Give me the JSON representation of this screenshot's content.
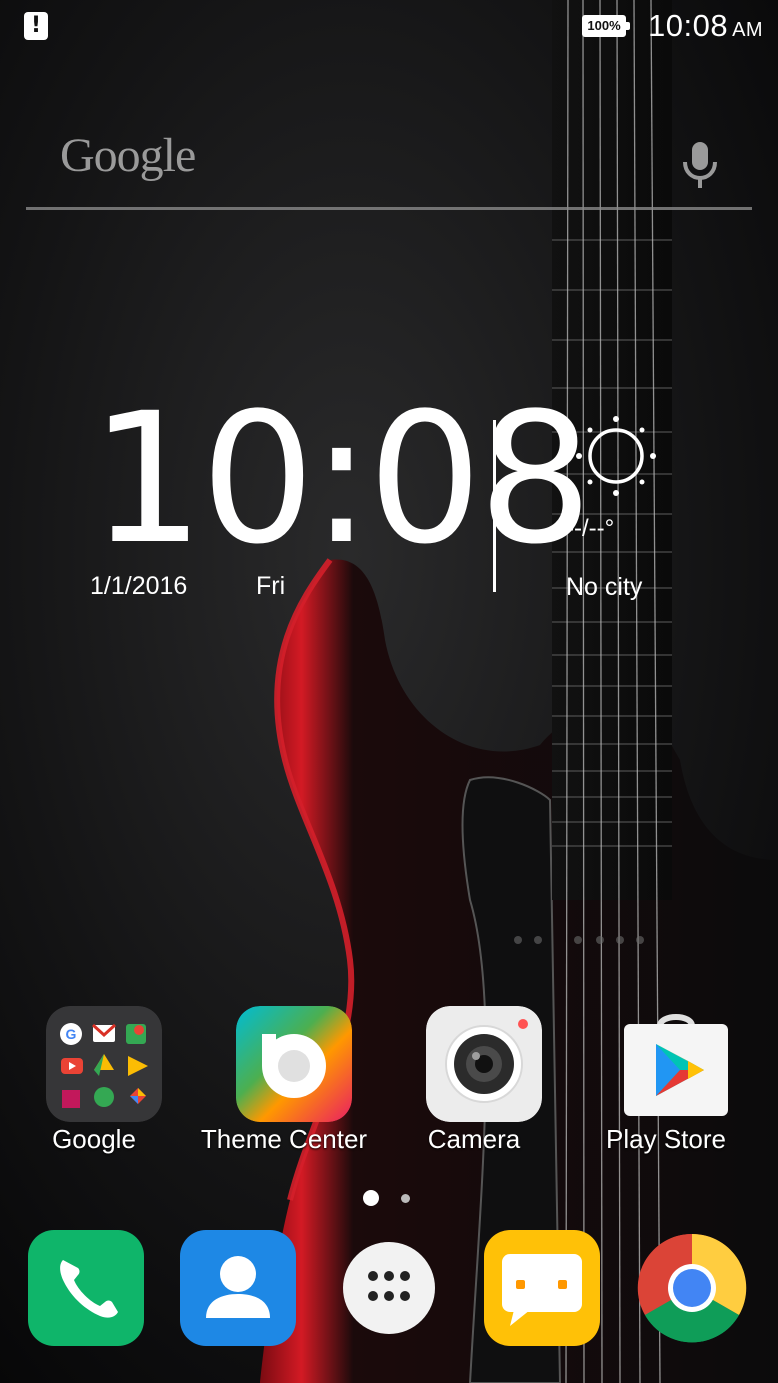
{
  "status_bar": {
    "time": "10:08",
    "ampm": "AM",
    "battery": "100%"
  },
  "search": {
    "logo": "Google"
  },
  "clock_widget": {
    "time_hours": "10",
    "time_minutes": "08",
    "date": "1/1/2016",
    "day": "Fri"
  },
  "weather": {
    "temperature": "--/--°",
    "city": "No city"
  },
  "home_apps": [
    {
      "label": "Google",
      "icon": "google-folder-icon"
    },
    {
      "label": "Theme Center",
      "icon": "theme-center-icon"
    },
    {
      "label": "Camera",
      "icon": "camera-icon"
    },
    {
      "label": "Play Store",
      "icon": "play-store-icon"
    }
  ],
  "page_indicator": {
    "pages": 2,
    "current": 1
  },
  "dock": [
    {
      "icon": "phone-icon"
    },
    {
      "icon": "contacts-icon"
    },
    {
      "icon": "app-drawer-icon"
    },
    {
      "icon": "messages-icon"
    },
    {
      "icon": "chrome-icon"
    }
  ],
  "colors": {
    "phone": "#0fb56a",
    "contacts": "#1e88e5",
    "messages": "#ffc107",
    "guitar_red": "#b0101a"
  }
}
